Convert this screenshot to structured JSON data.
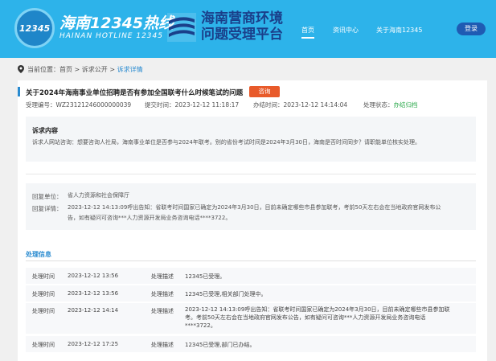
{
  "header": {
    "logo_badge_text": "12345",
    "logo_title": "海南12345热线",
    "logo_subtitle": "HAINAN HOTLINE 12345",
    "platform_line1": "海南营商环境",
    "platform_line2": "问题受理平台",
    "nav": [
      {
        "label": "首页",
        "active": true
      },
      {
        "label": "资讯中心",
        "active": false
      },
      {
        "label": "关于海南12345",
        "active": false
      }
    ],
    "login_label": "登录",
    "colors": {
      "bar": "#2db3ea",
      "platform_text": "#1a3f8a",
      "login": "#1f5bb3"
    }
  },
  "breadcrumb": {
    "prefix": "当前位置：",
    "items": [
      "首页",
      "诉求公开"
    ],
    "separator": " > ",
    "current": "诉求详情"
  },
  "detail": {
    "title": "关于2024年海南事业单位招聘是否有参加全国联考什么时候笔试的问题",
    "tag": "咨询",
    "meta": {
      "id_label": "受理编号：",
      "id_value": "WZ23121246000000039",
      "submit_label": "提交时间：",
      "submit_value": "2023-12-12 11:18:17",
      "finish_label": "办结时间：",
      "finish_value": "2023-12-12 14:14:04",
      "status_label": "处理状态：",
      "status_value": "办结归档"
    },
    "content_title": "诉求内容",
    "content_text": "诉求人网站咨询：想要咨询人社局，海南事业单位是否参与2024年联考。别的省份考试时间是2024年3月30日，海南是否时间同步？请职能单位核实处理。",
    "reply": {
      "unit_label": "回复单位：",
      "unit_value": "省人力资源和社会保障厅",
      "detail_label": "回复详情：",
      "detail_line1": "2023-12-12 14:13:09呼出告知：省联考时间国家已确定为2024年3月30日，目前未确定哪些市县参加联考，考前50天左右会在当地政府官网发布公",
      "detail_line2": "告，如有疑问可咨询***人力资源开发局业务咨询电话****3722。"
    }
  },
  "process": {
    "section_title": "处理信息",
    "time_label": "处理时间",
    "desc_label": "处理描述",
    "rows": [
      {
        "time": "2023-12-12 13:56",
        "desc": "12345已受理。"
      },
      {
        "time": "2023-12-12 13:56",
        "desc": "12345已受理,相关部门处理中。"
      },
      {
        "time": "2023-12-12 14:14",
        "desc": "2023-12-12 14:13:09呼出告知：省联考时间国家已确定为2024年3月30日，目前未确定哪些市县参加联考。考前50天左右会在当地政府官网发布公告，如有疑问可咨询***人力资源开发局业务咨询电话****3722。"
      },
      {
        "time": "2023-12-12 17:25",
        "desc": "12345已受理,部门已办结。"
      }
    ]
  }
}
